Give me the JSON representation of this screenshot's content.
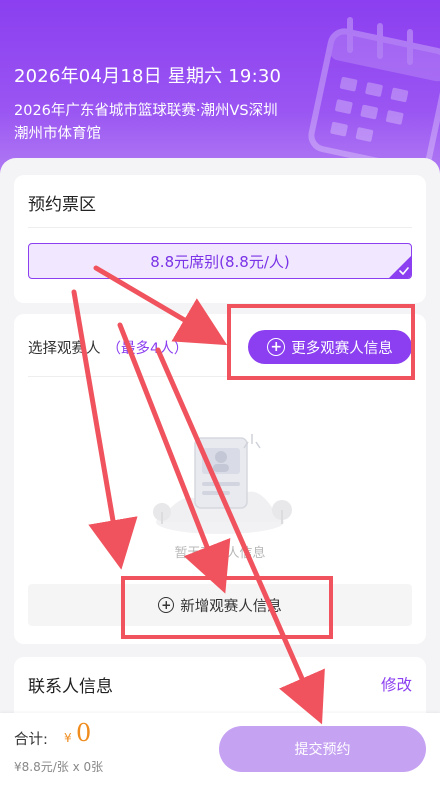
{
  "hero": {
    "datetime": "2026年04月18日 星期六 19:30",
    "match": "2026年广东省城市篮球联赛·潮州VS深圳",
    "venue": "潮州市体育馆"
  },
  "tickets": {
    "section_title": "预约票区",
    "option_label": "8.8元席别(8.8元/人)",
    "option_selected": true
  },
  "audience": {
    "label": "选择观赛人",
    "max_note": "（最多4人）",
    "more_button": "更多观赛人信息",
    "empty_text": "暂无观赛人信息",
    "add_button": "新增观赛人信息"
  },
  "contact": {
    "title": "联系人信息",
    "edit_link": "修改"
  },
  "footer": {
    "total_label": "合计:",
    "currency": "¥",
    "total_amount": "0",
    "price_detail": "¥8.8元/张 x 0张",
    "submit_button": "提交预约"
  },
  "colors": {
    "brand": "#8b3ff0",
    "price": "#f08c1e",
    "annotation": "#f0535d"
  },
  "icons": {
    "hero_decoration": "calendar-icon",
    "selected_check": "check-icon",
    "plus": "plus-circle-icon",
    "empty_state": "id-card-icon"
  }
}
